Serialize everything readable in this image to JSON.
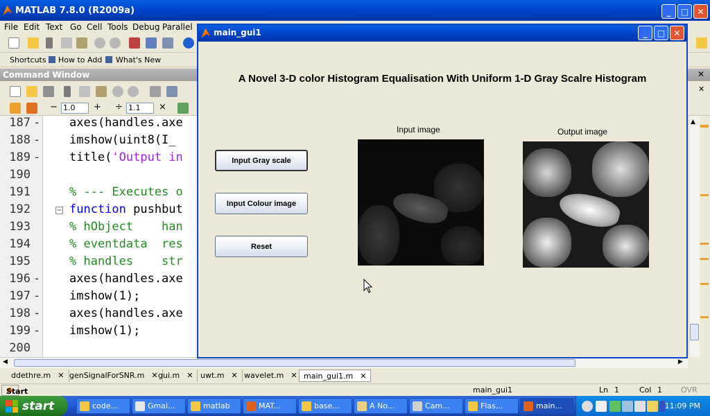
{
  "matlab": {
    "title": "MATLAB  7.8.0 (R2009a)",
    "menu": [
      "File",
      "Edit",
      "Text",
      "Go",
      "Cell",
      "Tools",
      "Debug",
      "Parallel"
    ],
    "shortcuts": {
      "shortcuts_label": "Shortcuts",
      "how_to_add": "How to Add",
      "whats_new": "What's New"
    },
    "command_window_title": "Command Window",
    "toolbar3": {
      "minus": "−",
      "value1": "1.0",
      "plus": "+",
      "divide": "÷",
      "value2": "1.1",
      "times": "×"
    }
  },
  "editor": {
    "lines": [
      {
        "num": "187",
        "dash": "-",
        "code": [
          {
            "t": "axes(handles.axe",
            "c": "plain"
          }
        ]
      },
      {
        "num": "188",
        "dash": "-",
        "code": [
          {
            "t": "imshow(uint8(I_",
            "c": "plain"
          }
        ]
      },
      {
        "num": "189",
        "dash": "-",
        "code": [
          {
            "t": "title(",
            "c": "plain"
          },
          {
            "t": "'Output in",
            "c": "st"
          }
        ]
      },
      {
        "num": "190",
        "dash": "",
        "code": []
      },
      {
        "num": "191",
        "dash": "",
        "code": [
          {
            "t": "% --- Executes o",
            "c": "cm"
          }
        ]
      },
      {
        "num": "192",
        "dash": "",
        "code": [
          {
            "t": "function ",
            "c": "kw"
          },
          {
            "t": "pushbut",
            "c": "plain"
          }
        ]
      },
      {
        "num": "193",
        "dash": "",
        "code": [
          {
            "t": "% hObject    han",
            "c": "cm"
          }
        ]
      },
      {
        "num": "194",
        "dash": "",
        "code": [
          {
            "t": "% eventdata  res",
            "c": "cm"
          }
        ]
      },
      {
        "num": "195",
        "dash": "",
        "code": [
          {
            "t": "% handles    str",
            "c": "cm"
          }
        ]
      },
      {
        "num": "196",
        "dash": "-",
        "code": [
          {
            "t": "axes(handles.axe",
            "c": "plain"
          }
        ]
      },
      {
        "num": "197",
        "dash": "-",
        "code": [
          {
            "t": "imshow(1);",
            "c": "plain"
          }
        ]
      },
      {
        "num": "198",
        "dash": "-",
        "code": [
          {
            "t": "axes(handles.axe",
            "c": "plain"
          }
        ]
      },
      {
        "num": "199",
        "dash": "-",
        "code": [
          {
            "t": "imshow(1);",
            "c": "plain"
          }
        ]
      },
      {
        "num": "200",
        "dash": "",
        "code": []
      }
    ]
  },
  "file_tabs": [
    {
      "label": "ddethre.m",
      "active": false
    },
    {
      "label": "genSignalForSNR.m",
      "active": false
    },
    {
      "label": "gui.m",
      "active": false
    },
    {
      "label": "uwt.m",
      "active": false
    },
    {
      "label": "wavelet.m",
      "active": false
    },
    {
      "label": "main_gui1.m",
      "active": true
    }
  ],
  "statusbar": {
    "start": "Start",
    "file": "main_gui1",
    "ln_label": "Ln",
    "ln": "1",
    "col_label": "Col",
    "col": "1",
    "mode": "OVR"
  },
  "gui": {
    "title": "main_gui1",
    "heading": "A Novel 3-D color Histogram Equalisation With Uniform 1-D Gray Scalre Histogram",
    "buttons": [
      "Input Gray scale",
      "Input Colour image",
      "Reset"
    ],
    "input_label": "Input image",
    "output_label": "Output image"
  },
  "taskbar": {
    "start": "start",
    "tasks": [
      {
        "label": "code...",
        "color": "#f4c842"
      },
      {
        "label": "Gmai...",
        "color": "#e8e8e8"
      },
      {
        "label": "matlab",
        "color": "#f4c842"
      },
      {
        "label": "MAT...",
        "color": "#e06020"
      },
      {
        "label": "base...",
        "color": "#f4c842"
      },
      {
        "label": "A No...",
        "color": "#e8d080"
      },
      {
        "label": "Cam...",
        "color": "#d0d0d0"
      },
      {
        "label": "Flas...",
        "color": "#f4c842"
      },
      {
        "label": "main...",
        "color": "#e06020"
      }
    ],
    "clock": "11:09 PM"
  }
}
